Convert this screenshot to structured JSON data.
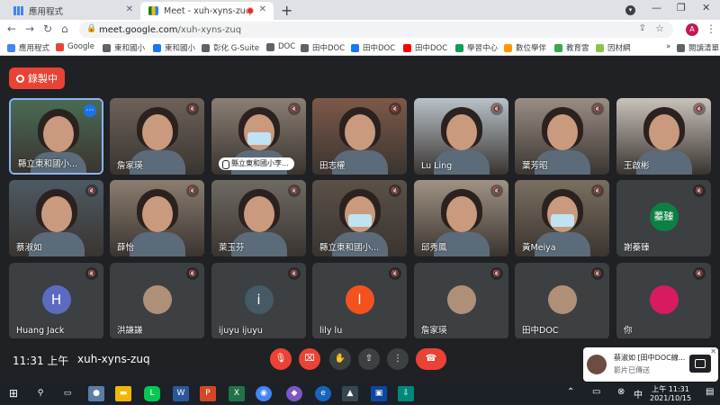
{
  "browser": {
    "tabs": [
      {
        "title": "應用程式",
        "active": false
      },
      {
        "title": "Meet - xuh-xyns-zuq",
        "active": true
      }
    ],
    "url_host": "meet.google.com",
    "url_path": "/xuh-xyns-zuq",
    "profile_letter": "A"
  },
  "bookmarks": [
    {
      "label": "應用程式",
      "color": "#4285f4"
    },
    {
      "label": "Google",
      "color": "#ea4335"
    },
    {
      "label": "東和國小",
      "color": "#5f6368"
    },
    {
      "label": "東和國小",
      "color": "#1877f2"
    },
    {
      "label": "彰化 G-Suite",
      "color": "#5f6368"
    },
    {
      "label": "DOC",
      "color": "#5f6368"
    },
    {
      "label": "田中DOC",
      "color": "#5f6368"
    },
    {
      "label": "田中DOC",
      "color": "#1877f2"
    },
    {
      "label": "田中DOC",
      "color": "#ff0000"
    },
    {
      "label": "學習中心",
      "color": "#0f9d58"
    },
    {
      "label": "數位學伴",
      "color": "#ff9800"
    },
    {
      "label": "教育雲",
      "color": "#34a853"
    },
    {
      "label": "因材網",
      "color": "#8bc34a"
    }
  ],
  "reading_list": "閱讀清單",
  "meet": {
    "recording_label": "錄製中",
    "time": "11:31 上午",
    "meeting_code": "xuh-xyns-zuq",
    "participants": [
      {
        "name": "縣立東和國小...",
        "type": "video",
        "active": true
      },
      {
        "name": "詹家瑛",
        "type": "video"
      },
      {
        "name": "縣立東和國小李...",
        "type": "video",
        "pinned": true
      },
      {
        "name": "田志權",
        "type": "video"
      },
      {
        "name": "Lu Ling",
        "type": "video"
      },
      {
        "name": "葉芳昭",
        "type": "video"
      },
      {
        "name": "王啟彬",
        "type": "video"
      },
      {
        "name": "蔡淑如",
        "type": "video"
      },
      {
        "name": "薛怡",
        "type": "video"
      },
      {
        "name": "萊玉芬",
        "type": "video"
      },
      {
        "name": "縣立東和國小...",
        "type": "video"
      },
      {
        "name": "邱秀鳳",
        "type": "video"
      },
      {
        "name": "黃Meiya",
        "type": "video"
      },
      {
        "name": "謝蓁臻",
        "type": "avatar",
        "initial": "蓁臻",
        "color": "#0b8043"
      },
      {
        "name": "Huang Jack",
        "type": "avatar",
        "initial": "H",
        "color": "#5c6bc0"
      },
      {
        "name": "洪謙謙",
        "type": "photo"
      },
      {
        "name": "ijuyu ijuyu",
        "type": "avatar",
        "initial": "i",
        "color": "#455a64"
      },
      {
        "name": "lily lu",
        "type": "avatar",
        "initial": "l",
        "color": "#f4511e"
      },
      {
        "name": "詹家瑛",
        "type": "photo"
      },
      {
        "name": "田中DOC",
        "type": "photo"
      },
      {
        "name": "你",
        "type": "avatar",
        "initial": "",
        "color": "#d81b60"
      }
    ]
  },
  "toast": {
    "title": "蔡淑如 [田中DOC線...",
    "subtitle": "影片已傳送"
  },
  "taskbar": {
    "time": "上午 11:31",
    "date": "2021/10/15"
  }
}
